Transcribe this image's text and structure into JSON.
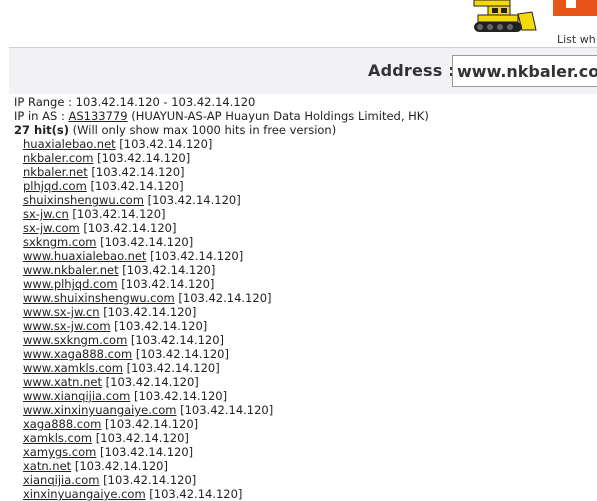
{
  "header": {
    "list_link_text": "List wh"
  },
  "address": {
    "label": "Address :",
    "value": "www.nkbaler.com"
  },
  "info": {
    "ip_range_label": "IP Range : ",
    "ip_range": "103.42.14.120 - 103.42.14.120",
    "as_label": "IP in AS : ",
    "as_number": "AS133779",
    "as_desc": " (HUAYUN-AS-AP Huayun Data Holdings Limited, HK)",
    "hits_count": "27 hit(s)",
    "hits_note": " (Will only show max 1000 hits in free version)"
  },
  "domain_ip_suffix": " [103.42.14.120]",
  "domains": [
    "huaxialebao.net",
    "nkbaler.com",
    "nkbaler.net",
    "plhjqd.com",
    "shuixinshengwu.com",
    "sx-jw.cn",
    "sx-jw.com",
    "sxkngm.com",
    "www.huaxialebao.net",
    "www.nkbaler.net",
    "www.plhjqd.com",
    "www.shuixinshengwu.com",
    "www.sx-jw.cn",
    "www.sx-jw.com",
    "www.sxkngm.com",
    "www.xaga888.com",
    "www.xamkls.com",
    "www.xatn.net",
    "www.xianqijia.com",
    "www.xinxinyuangaiye.com",
    "xaga888.com",
    "xamkls.com",
    "xamygs.com",
    "xatn.net",
    "xianqijia.com",
    "xinxinyuangaiye.com"
  ]
}
